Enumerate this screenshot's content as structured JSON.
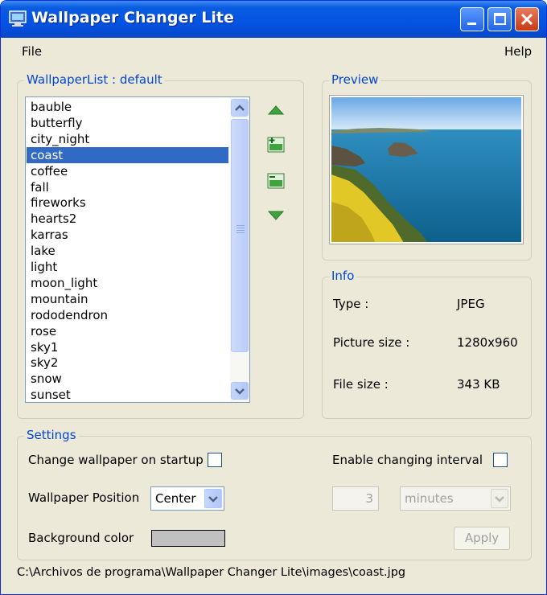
{
  "window": {
    "title": "Wallpaper Changer Lite",
    "title_icon": "monitor-icon"
  },
  "menu": {
    "file": "File",
    "help": "Help"
  },
  "wallpaper_list": {
    "title": "WallpaperList : default",
    "items": [
      "bauble",
      "butterfly",
      "city_night",
      "coast",
      "coffee",
      "fall",
      "fireworks",
      "hearts2",
      "karras",
      "lake",
      "light",
      "moon_light",
      "mountain",
      "rododendron",
      "rose",
      "sky1",
      "sky2",
      "snow",
      "sunset"
    ],
    "selected": "coast",
    "side_icons": [
      "move-up-icon",
      "add-image-icon",
      "remove-image-icon",
      "move-down-icon"
    ]
  },
  "preview": {
    "title": "Preview"
  },
  "info": {
    "title": "Info",
    "type_label": "Type :",
    "type_value": "JPEG",
    "size_label": "Picture size :",
    "size_value": "1280x960",
    "file_label": "File size :",
    "file_value": "343 KB"
  },
  "settings": {
    "title": "Settings",
    "startup_label": "Change wallpaper on startup",
    "startup_checked": false,
    "interval_label": "Enable changing interval",
    "interval_checked": false,
    "position_label": "Wallpaper Position",
    "position_value": "Center",
    "interval_value": "3",
    "interval_unit": "minutes",
    "bgcolor_label": "Background color",
    "bgcolor": "#c0c0c0",
    "apply_label": "Apply"
  },
  "status": {
    "path": "C:\\Archivos de programa\\Wallpaper Changer Lite\\images\\coast.jpg"
  },
  "colors": {
    "accent": "#0046d5",
    "selection": "#316ac5",
    "titlebar": "#0553e3"
  }
}
